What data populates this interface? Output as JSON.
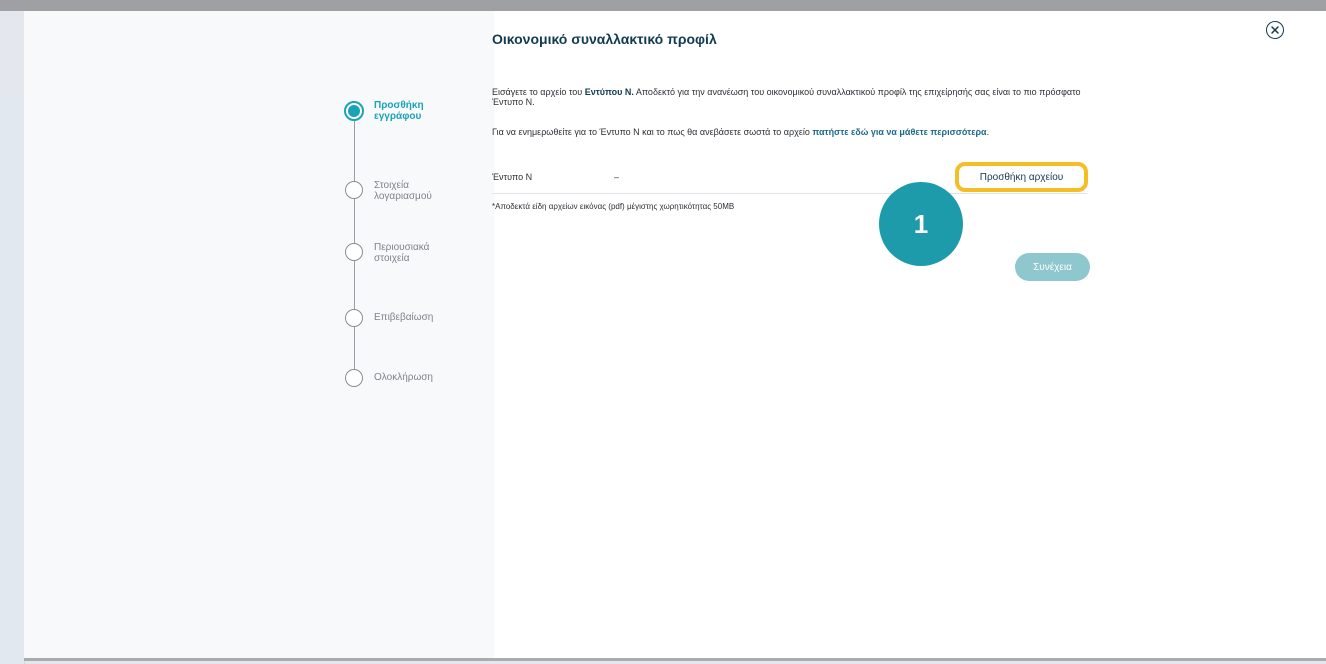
{
  "modal": {
    "title": "Οικονομικό συναλλακτικό προφίλ",
    "close_icon": "close-icon"
  },
  "steps": [
    {
      "label": "Προσθήκη εγγράφου",
      "active": true
    },
    {
      "label": "Στοιχεία λογαριασμού",
      "active": false
    },
    {
      "label": "Περιουσιακά στοιχεία",
      "active": false
    },
    {
      "label": "Επιβεβαίωση",
      "active": false
    },
    {
      "label": "Ολοκλήρωση",
      "active": false
    }
  ],
  "content": {
    "intro_prefix": "Εισάγετε το αρχείο του ",
    "intro_bold": "Εντύπου Ν.",
    "intro_suffix": " Αποδεκτό για την ανανέωση του οικονομικού συναλλακτικού προφίλ της επιχείρησής σας είναι το πιο πρόσφατο Έντυπο Ν.",
    "info_prefix": "Για να ενημερωθείτε για το Έντυπο Ν και το πως θα ανεβάσετε σωστά το αρχείο ",
    "info_link": "πατήστε εδώ για να μάθετε περισσότερα",
    "info_suffix": ".",
    "file_row_label": "Έντυπο Ν",
    "file_row_value": "–",
    "add_file_label": "Προσθήκη αρχείου",
    "note": "*Αποδεκτά είδη αρχείων εικόνας (pdf) μέγιστης χωρητικότητας 50MB",
    "continue_label": "Συνέχεια"
  },
  "annotation": {
    "badge_number": "1"
  },
  "colors": {
    "accent": "#1aa3b7",
    "highlight": "#f5bd26",
    "title": "#123a52",
    "continue_disabled": "#8fc7ce"
  }
}
